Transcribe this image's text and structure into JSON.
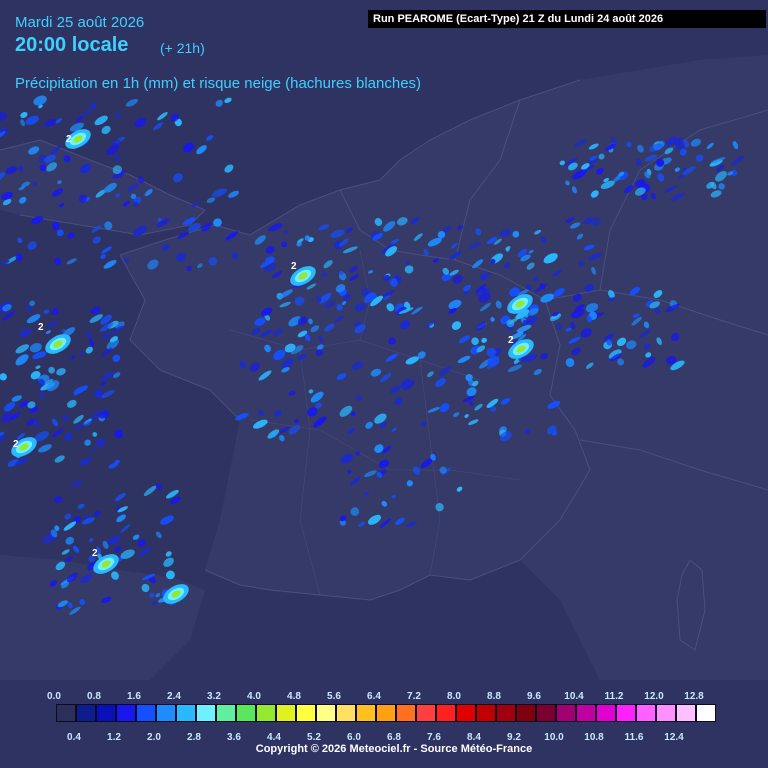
{
  "header": {
    "date": "Mardi 25 août 2026",
    "time_local": "20:00 locale",
    "lead": "(+ 21h)",
    "parameter": "Précipitation en 1h (mm) et risque neige (hachures blanches)",
    "run": "Run PEAROME (Ecart-Type) 21 Z du Lundi 24 août 2026"
  },
  "legend": {
    "top_labels": [
      "0.0",
      "0.8",
      "1.6",
      "2.4",
      "3.2",
      "4.0",
      "4.8",
      "5.6",
      "6.4",
      "7.2",
      "8.0",
      "8.8",
      "9.6",
      "10.4",
      "11.2",
      "12.0",
      "12.8"
    ],
    "bottom_labels": [
      "0.4",
      "1.2",
      "2.0",
      "2.8",
      "3.6",
      "4.4",
      "5.2",
      "6.0",
      "6.8",
      "7.6",
      "8.4",
      "9.2",
      "10.0",
      "10.8",
      "11.6",
      "12.4"
    ],
    "colors": [
      "#2b2f5a",
      "#0d1d8c",
      "#0a10b8",
      "#1818ee",
      "#1450ff",
      "#1d8cff",
      "#2ab8ff",
      "#6ef0ff",
      "#5ef0a0",
      "#59e85c",
      "#95e830",
      "#e0f020",
      "#ffff40",
      "#ffff88",
      "#ffe060",
      "#ffc020",
      "#ffa010",
      "#ff7020",
      "#ff4040",
      "#ff2020",
      "#e00000",
      "#c00000",
      "#a00010",
      "#800010",
      "#7a0030",
      "#a00070",
      "#c000a0",
      "#e000d0",
      "#ff20ff",
      "#ff60ff",
      "#ff90ff",
      "#ffc0ff",
      "#ffffff"
    ]
  },
  "contour_labels": [
    "2",
    "2",
    "2",
    "2",
    "2",
    "2"
  ],
  "copyright": "Copyright © 2026 Meteociel.fr - Source Météo-France"
}
